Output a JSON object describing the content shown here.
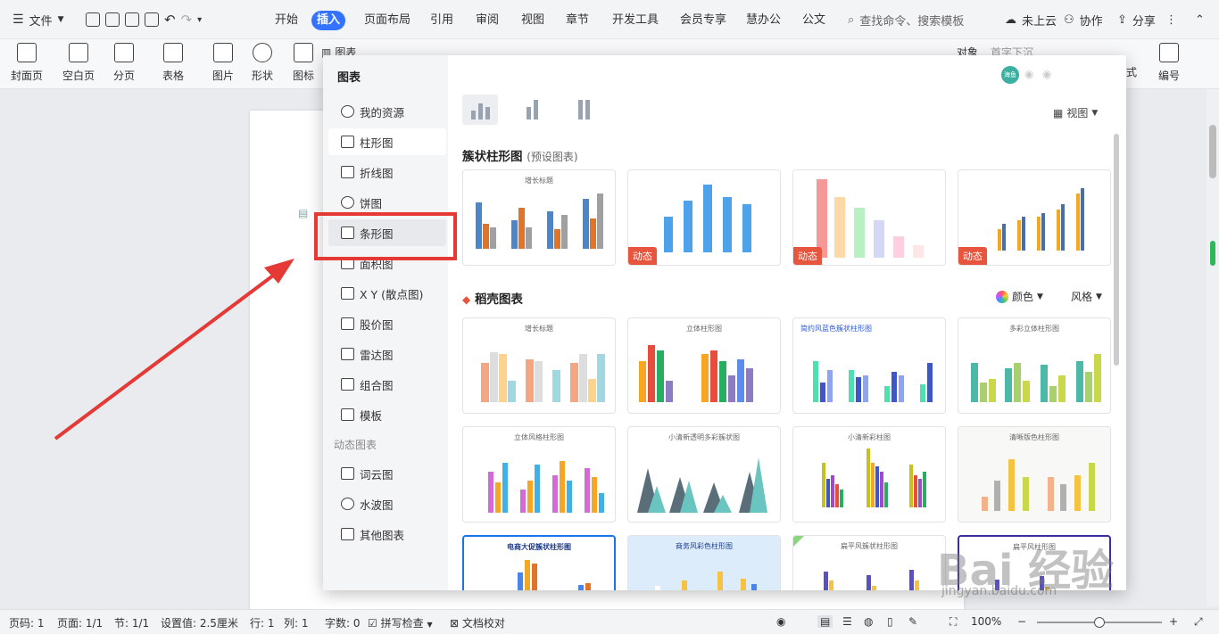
{
  "menubar": {
    "file_label": "文件",
    "tabs": [
      "开始",
      "插入",
      "页面布局",
      "引用",
      "审阅",
      "视图",
      "章节",
      "开发工具",
      "会员专享",
      "慧办公",
      "公文"
    ],
    "active_tab": "插入",
    "search_placeholder": "查找命令、搜索模板",
    "cloud_label": "未上云",
    "collab_label": "协作",
    "share_label": "分享"
  },
  "ribbon": {
    "buttons": [
      "封面页",
      "空白页",
      "分页",
      "表格",
      "图片",
      "形状",
      "图标",
      "图表"
    ],
    "right": [
      "对象",
      "首字下沉",
      "式",
      "编号"
    ]
  },
  "dialog": {
    "title": "图表",
    "sidebar": {
      "items": [
        "我的资源",
        "柱形图",
        "折线图",
        "饼图",
        "条形图",
        "面积图",
        "X Y (散点图)",
        "股价图",
        "雷达图",
        "组合图",
        "模板"
      ],
      "dynamic_header": "动态图表",
      "dynamic_items": [
        "词云图",
        "水波图",
        "其他图表"
      ]
    },
    "view_label": "视图",
    "section1_title": "簇状柱形图",
    "section1_sub": "(预设图表)",
    "section2_title": "稻壳图表",
    "color_label": "颜色",
    "style_label": "风格",
    "dynamic_badge": "动态",
    "avatar_text": "海鱼",
    "card_titles": [
      "增长标题",
      "立体柱形图",
      "简约风蓝色簇状柱形图",
      "多彩立体柱形图",
      "立体风格柱形图",
      "小清新透明多彩簇状图",
      "小清新彩柱图",
      "清晰版色柱形图",
      "电商大促簇状柱形图",
      "商务风彩色柱形图",
      "扁平风簇状柱形图",
      "扁平风柱形图"
    ]
  },
  "status": {
    "page": "页码: 1",
    "pages": "页面: 1/1",
    "section": "节: 1/1",
    "setting": "设置值: 2.5厘米",
    "row": "行: 1",
    "col": "列: 1",
    "words": "字数: 0",
    "spell": "拼写检查",
    "proof": "文档校对",
    "zoom": "100%"
  },
  "watermark": {
    "main": "Bai 经验",
    "sub": "jingyan.baidu.com"
  },
  "colors": {
    "accent": "#3473ff",
    "highlight_box": "#e53935",
    "arrow": "#e53935"
  }
}
